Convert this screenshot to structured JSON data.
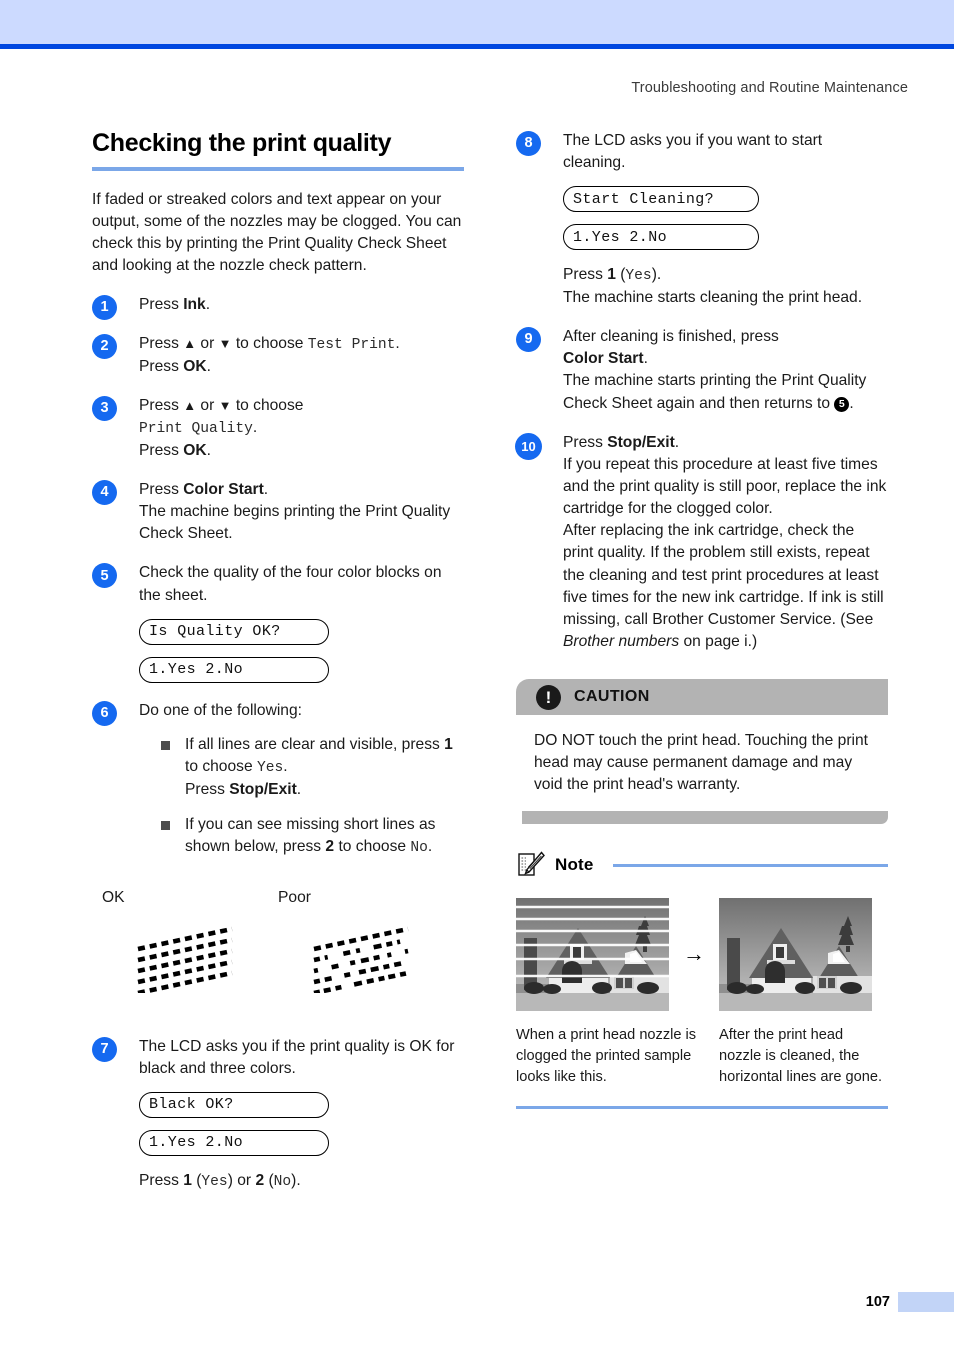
{
  "header": {
    "running_head": "Troubleshooting and Routine Maintenance"
  },
  "footer": {
    "page_number": "107"
  },
  "colors": {
    "header_band": "#ccdaff",
    "header_rule": "#0047e0",
    "accent_rule": "#7ba7e8",
    "step_circle": "#1569f0",
    "caution_gray": "#b3b3b3",
    "page_tab": "#c2d4f7"
  },
  "section": {
    "title": "Checking the print quality",
    "intro": "If faded or streaked colors and text appear on your output, some of the nozzles may be clogged. You can check this by printing the Print Quality Check Sheet and looking at the nozzle check pattern."
  },
  "steps": {
    "s1": {
      "num": "1",
      "t1": "Press ",
      "b1": "Ink",
      "t2": "."
    },
    "s2": {
      "num": "2",
      "l1a": "Press ",
      "l1b": "▲",
      "l1c": " or ",
      "l1d": "▼",
      "l1e": " to choose ",
      "l1mono": "Test Print",
      "l1f": ".",
      "l2a": "Press ",
      "l2b": "OK",
      "l2c": "."
    },
    "s3": {
      "num": "3",
      "l1a": "Press ",
      "l1b": "▲",
      "l1c": " or ",
      "l1d": "▼",
      "l1e": " to choose",
      "l2mono": "Print Quality",
      "l2f": ".",
      "l3a": "Press ",
      "l3b": "OK",
      "l3c": "."
    },
    "s4": {
      "num": "4",
      "l1a": "Press ",
      "l1b": "Color Start",
      "l1c": ".",
      "l2": "The machine begins printing the Print Quality Check Sheet."
    },
    "s5": {
      "num": "5",
      "l1": "Check the quality of the four color blocks on the sheet.",
      "lcd1": "Is Quality OK?",
      "lcd2": "1.Yes 2.No"
    },
    "s6": {
      "num": "6",
      "l1": "Do one of the following:",
      "b1a": "If all lines are clear and visible, press ",
      "b1b": "1",
      "b1c": " to choose ",
      "b1mono": "Yes",
      "b1d": ".",
      "b1e": "Press ",
      "b1f": "Stop/Exit",
      "b1g": ".",
      "b2a": "If you can see missing short lines as shown below, press ",
      "b2b": "2",
      "b2c": " to choose ",
      "b2mono": "No",
      "b2d": "."
    },
    "samples": {
      "ok_label": "OK",
      "poor_label": "Poor"
    },
    "s7": {
      "num": "7",
      "l1": "The LCD asks you if the print quality is OK for black and three colors.",
      "lcd1": "Black OK?",
      "lcd2": "1.Yes 2.No",
      "l2a": "Press ",
      "l2b": "1",
      "l2c": " (",
      "l2mono1": "Yes",
      "l2d": ") or ",
      "l2e": "2",
      "l2f": " (",
      "l2mono2": "No",
      "l2g": ")."
    },
    "s8": {
      "num": "8",
      "l1": "The LCD asks you if you want to start cleaning.",
      "lcd1": "Start Cleaning?",
      "lcd2": "1.Yes 2.No",
      "l2a": "Press ",
      "l2b": "1",
      "l2c": " (",
      "l2mono": "Yes",
      "l2d": ").",
      "l3": "The machine starts cleaning the print head."
    },
    "s9": {
      "num": "9",
      "l1a": "After cleaning is finished, press ",
      "l1b": "Color Start",
      "l1c": ".",
      "l2a": "The machine starts printing the Print Quality Check Sheet again and then returns to ",
      "l2ref": "5",
      "l2b": "."
    },
    "s10": {
      "num": "10",
      "l1a": "Press ",
      "l1b": "Stop/Exit",
      "l1c": ".",
      "l2": "If you repeat this procedure at least five times and the print quality is still poor, replace the ink cartridge for the clogged color.",
      "l3a": "After replacing the ink cartridge, check the print quality. If the problem still exists, repeat the cleaning and test print procedures at least five times for the new ink cartridge. If ink is still missing, call Brother Customer Service. (See ",
      "l3italic": "Brother numbers",
      "l3b": " on page i.)"
    }
  },
  "caution": {
    "icon": "exclamation-icon",
    "title": "CAUTION",
    "body": "DO NOT touch the print head. Touching the print head may cause permanent damage and may void the print head's warranty."
  },
  "note": {
    "icon": "notepad-pencil-icon",
    "title": "Note",
    "arrow": "→",
    "caption_left": "When a print head nozzle is clogged the printed sample looks like this.",
    "caption_right": "After the print head nozzle is cleaned, the horizontal lines are gone."
  }
}
